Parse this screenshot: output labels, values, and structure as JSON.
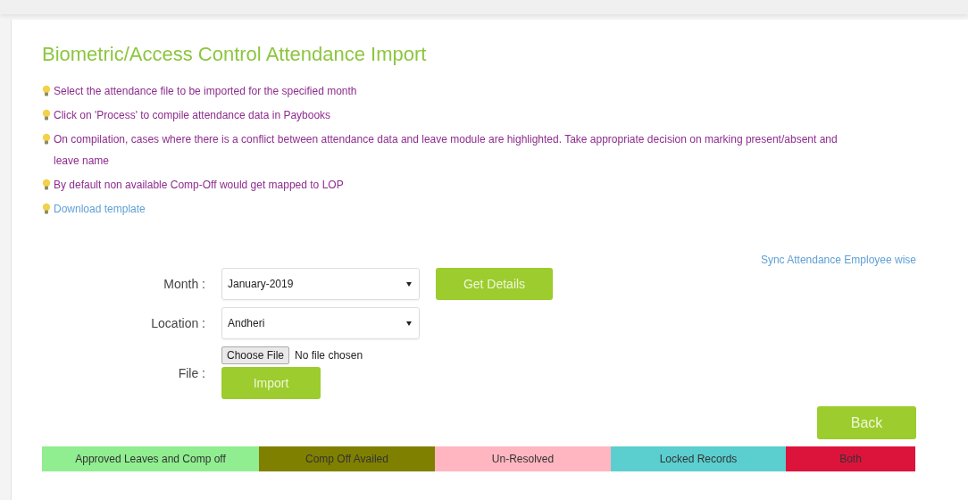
{
  "title": "Biometric/Access Control Attendance Import",
  "instructions": [
    {
      "kind": "text",
      "text": "Select the attendance file to be imported for the specified month"
    },
    {
      "kind": "text",
      "text": "Click on 'Process' to compile attendance data in Paybooks"
    },
    {
      "kind": "text",
      "text": "On compilation, cases where there is a conflict between attendance data and leave module are highlighted. Take appropriate decision on marking present/absent and leave name"
    },
    {
      "kind": "text",
      "text": "By default non available Comp-Off would get mapped to LOP"
    },
    {
      "kind": "link",
      "text": "Download template"
    }
  ],
  "sync_link": "Sync Attendance Employee wise",
  "form": {
    "month": {
      "label": "Month :",
      "value": "January-2019",
      "button": "Get Details"
    },
    "location": {
      "label": "Location :",
      "value": "Andheri"
    },
    "file": {
      "label": "File :",
      "choose_button": "Choose File",
      "status": "No file chosen",
      "button": "Import"
    }
  },
  "back_button": "Back",
  "legend": [
    {
      "label": "Approved Leaves and Comp off",
      "color": "#90ee90"
    },
    {
      "label": "Comp Off Availed",
      "color": "#808000"
    },
    {
      "label": "Un-Resolved",
      "color": "#ffb6c1"
    },
    {
      "label": "Locked Records",
      "color": "#5bcfcf"
    },
    {
      "label": "Both",
      "color": "#dc143c"
    }
  ]
}
